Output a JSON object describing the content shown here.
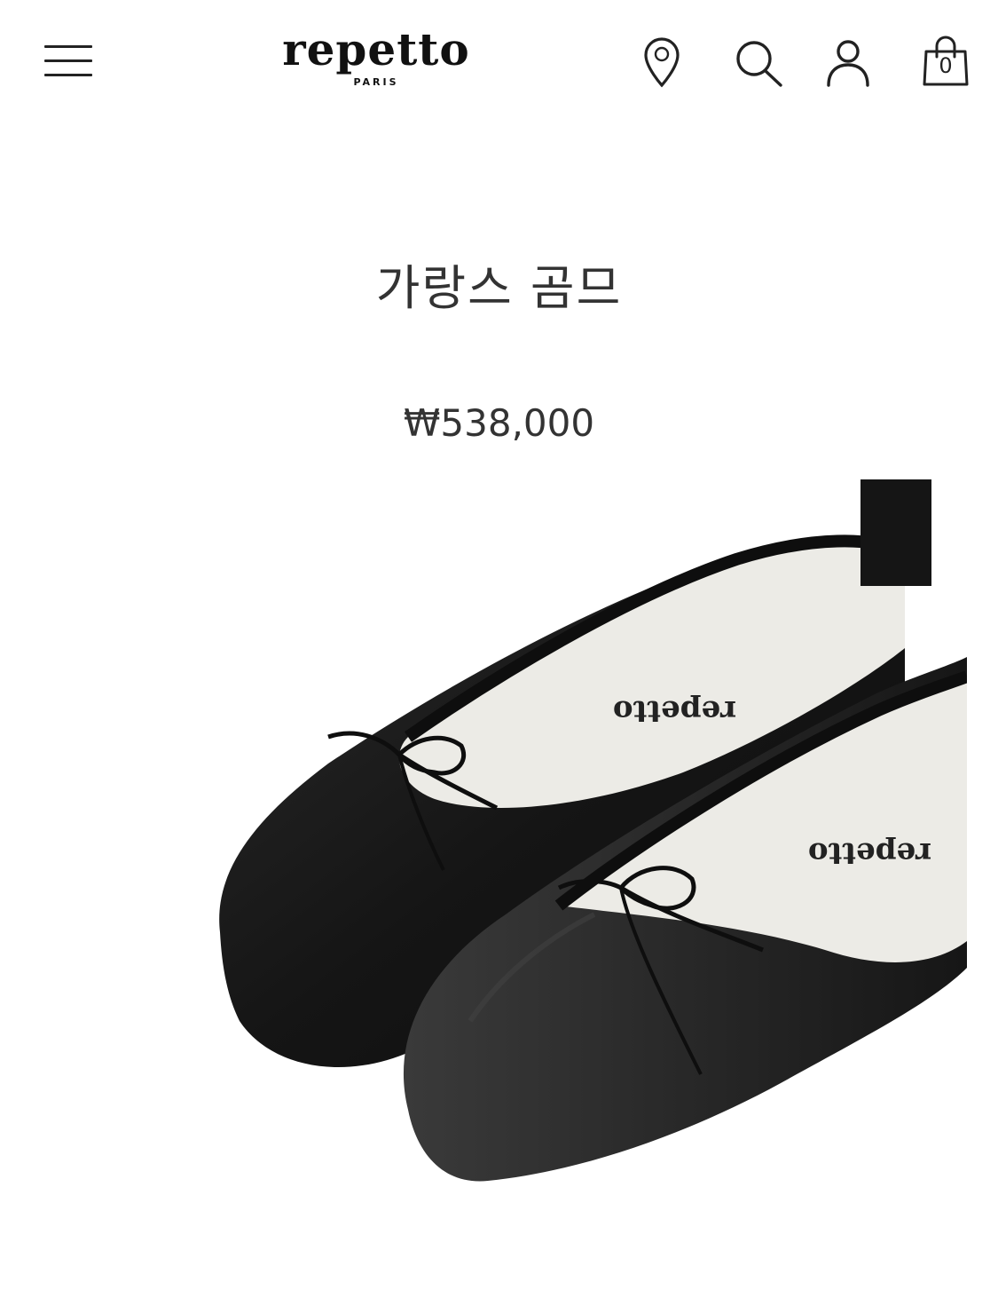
{
  "header": {
    "brand_name": "repetto",
    "brand_sub": "PARIS",
    "cart_count": "0",
    "icons": {
      "menu": "hamburger-menu-icon",
      "store_locator": "location-pin-icon",
      "search": "search-icon",
      "account": "user-icon",
      "cart": "shopping-bag-icon"
    }
  },
  "product": {
    "name": "가랑스 곰므",
    "price": "₩538,000",
    "image_alt": "black leather ballet flats with bow"
  },
  "colors": {
    "text": "#222222",
    "shoe": "#141414",
    "insole": "#ecebe6"
  }
}
